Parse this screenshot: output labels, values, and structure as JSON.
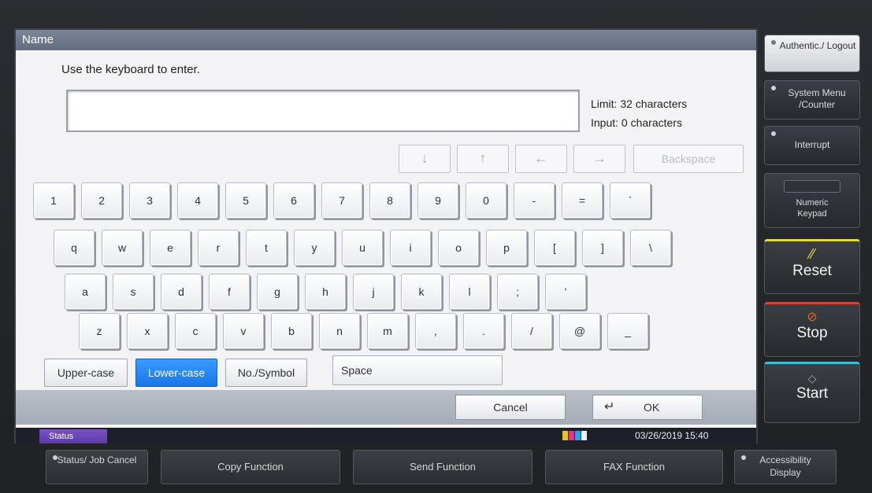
{
  "window": {
    "title": "Name"
  },
  "instruction": "Use the keyboard to enter.",
  "input": {
    "value": "",
    "limit": "Limit: 32 characters",
    "count": "Input: 0 characters"
  },
  "navigation": {
    "down": "↓",
    "up": "↑",
    "left": "←",
    "right": "→",
    "backspace": "Backspace"
  },
  "keyboard": {
    "row1": [
      "1",
      "2",
      "3",
      "4",
      "5",
      "6",
      "7",
      "8",
      "9",
      "0",
      "-",
      "=",
      "`"
    ],
    "row2": [
      "q",
      "w",
      "e",
      "r",
      "t",
      "y",
      "u",
      "i",
      "o",
      "p",
      "[",
      "]",
      "\\"
    ],
    "row3": [
      "a",
      "s",
      "d",
      "f",
      "g",
      "h",
      "j",
      "k",
      "l",
      ";",
      "'"
    ],
    "row4": [
      "z",
      "x",
      "c",
      "v",
      "b",
      "n",
      "m",
      ",",
      ".",
      "/",
      "@",
      "_"
    ]
  },
  "modes": {
    "upper": "Upper-case",
    "lower": "Lower-case",
    "symbol": "No./Symbol",
    "space": "Space",
    "active": "Lower-case"
  },
  "actions": {
    "cancel": "Cancel",
    "ok": "OK"
  },
  "status": {
    "tab": "Status",
    "datetime": "03/26/2019  15:40"
  },
  "hardware": {
    "authentic": "Authentic./ Logout",
    "system_menu": "System Menu /Counter",
    "interrupt": "Interrupt",
    "numeric_keypad": "Numeric Keypad",
    "reset": "Reset",
    "stop": "Stop",
    "start": "Start"
  },
  "functions": {
    "status_job": "Status/ Job Cancel",
    "copy": "Copy Function",
    "send": "Send Function",
    "fax": "FAX Function",
    "accessibility": "Accessibility Display"
  },
  "colors": {
    "accent": "#1677e8",
    "titlebar": "#6c7588",
    "stop": "#e36a2a",
    "reset_line": "#e0d64a",
    "stop_line": "#d8423a",
    "start_line": "#3bc0d6"
  }
}
